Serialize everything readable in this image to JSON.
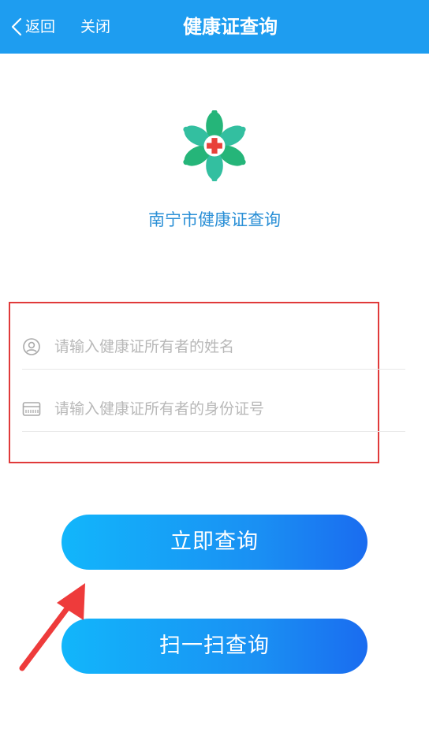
{
  "nav": {
    "back_label": "返回",
    "close_label": "关闭",
    "title": "健康证查询"
  },
  "brand": {
    "title": "南宁市健康证查询",
    "logo_icon": "health-flower-cross-logo",
    "color": "#2a8fd6"
  },
  "form": {
    "name_placeholder": "请输入健康证所有者的姓名",
    "name_value": "",
    "name_icon": "user-circle-icon",
    "id_placeholder": "请输入健康证所有者的身份证号",
    "id_value": "",
    "id_icon": "id-card-icon"
  },
  "buttons": {
    "query_label": "立即查询",
    "scan_label": "扫一扫查询"
  },
  "colors": {
    "nav_bg": "#1e9df0",
    "highlight_box": "#e03a3a",
    "annotation_arrow": "#ee3b3b",
    "button_gradient_start": "#12b6fb",
    "button_gradient_end": "#1a6cf0"
  }
}
